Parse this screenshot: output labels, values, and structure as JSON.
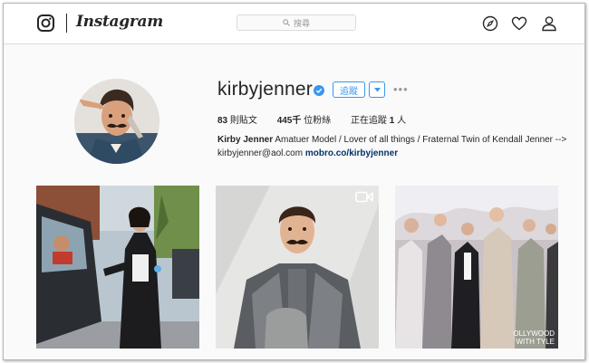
{
  "brand": {
    "wordmark": "Instagram"
  },
  "search": {
    "placeholder": "搜尋"
  },
  "nav": {
    "icons": [
      "explore-compass-icon",
      "activity-heart-icon",
      "profile-person-icon"
    ]
  },
  "profile": {
    "username": "kirbyjenner",
    "verified": true,
    "follow_label": "追蹤",
    "more_label": "•••",
    "stats": {
      "posts_count": "83",
      "posts_label": "則貼文",
      "followers_count": "445千",
      "followers_label": "位粉絲",
      "following_prefix": "正在追蹤",
      "following_count": "1",
      "following_suffix": "人"
    },
    "bio": {
      "name": "Kirby Jenner",
      "text": "Amatuer Model / Lover of all things / Fraternal Twin of Kendall Jenner --> kirbyjenner@aol.com",
      "link": "mobro.co/kirbyjenner"
    }
  },
  "colors": {
    "accent": "#3897f0",
    "link": "#003569",
    "verified": "#3897f0"
  }
}
